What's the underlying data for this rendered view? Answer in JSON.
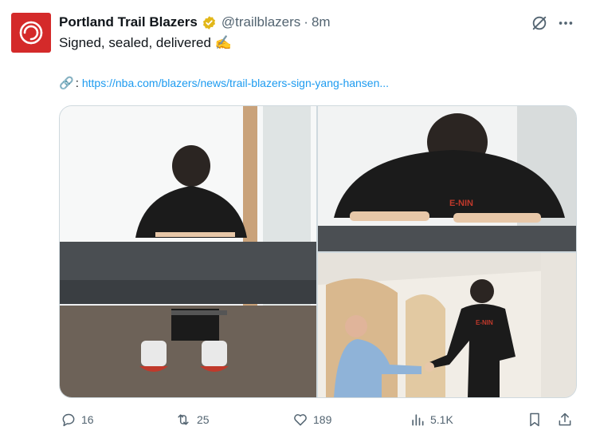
{
  "tweet": {
    "author_name": "Portland Trail Blazers",
    "handle": "@trailblazers",
    "separator": "·",
    "time": "8m",
    "text": "Signed, sealed, delivered ✍️",
    "link_emoji": "🔗",
    "link_colon": ":",
    "link_url": "https://nba.com/blazers/news/trail-blazers-sign-yang-hansen..."
  },
  "stats": {
    "replies": "16",
    "reposts": "25",
    "likes": "189",
    "views": "5.1K"
  },
  "colors": {
    "brand_red": "#d42a2a",
    "verified_gold": "#e2b719",
    "link_blue": "#1d9bf0",
    "muted_text": "#536471"
  },
  "icons": {
    "avatar": "trail-blazers-pinwheel-logo",
    "verified": "verified-badge",
    "grok": "grok-icon",
    "more": "more-icon",
    "reply": "reply-icon",
    "repost": "repost-icon",
    "like": "heart-icon",
    "views": "views-icon",
    "bookmark": "bookmark-icon",
    "share": "share-icon"
  }
}
